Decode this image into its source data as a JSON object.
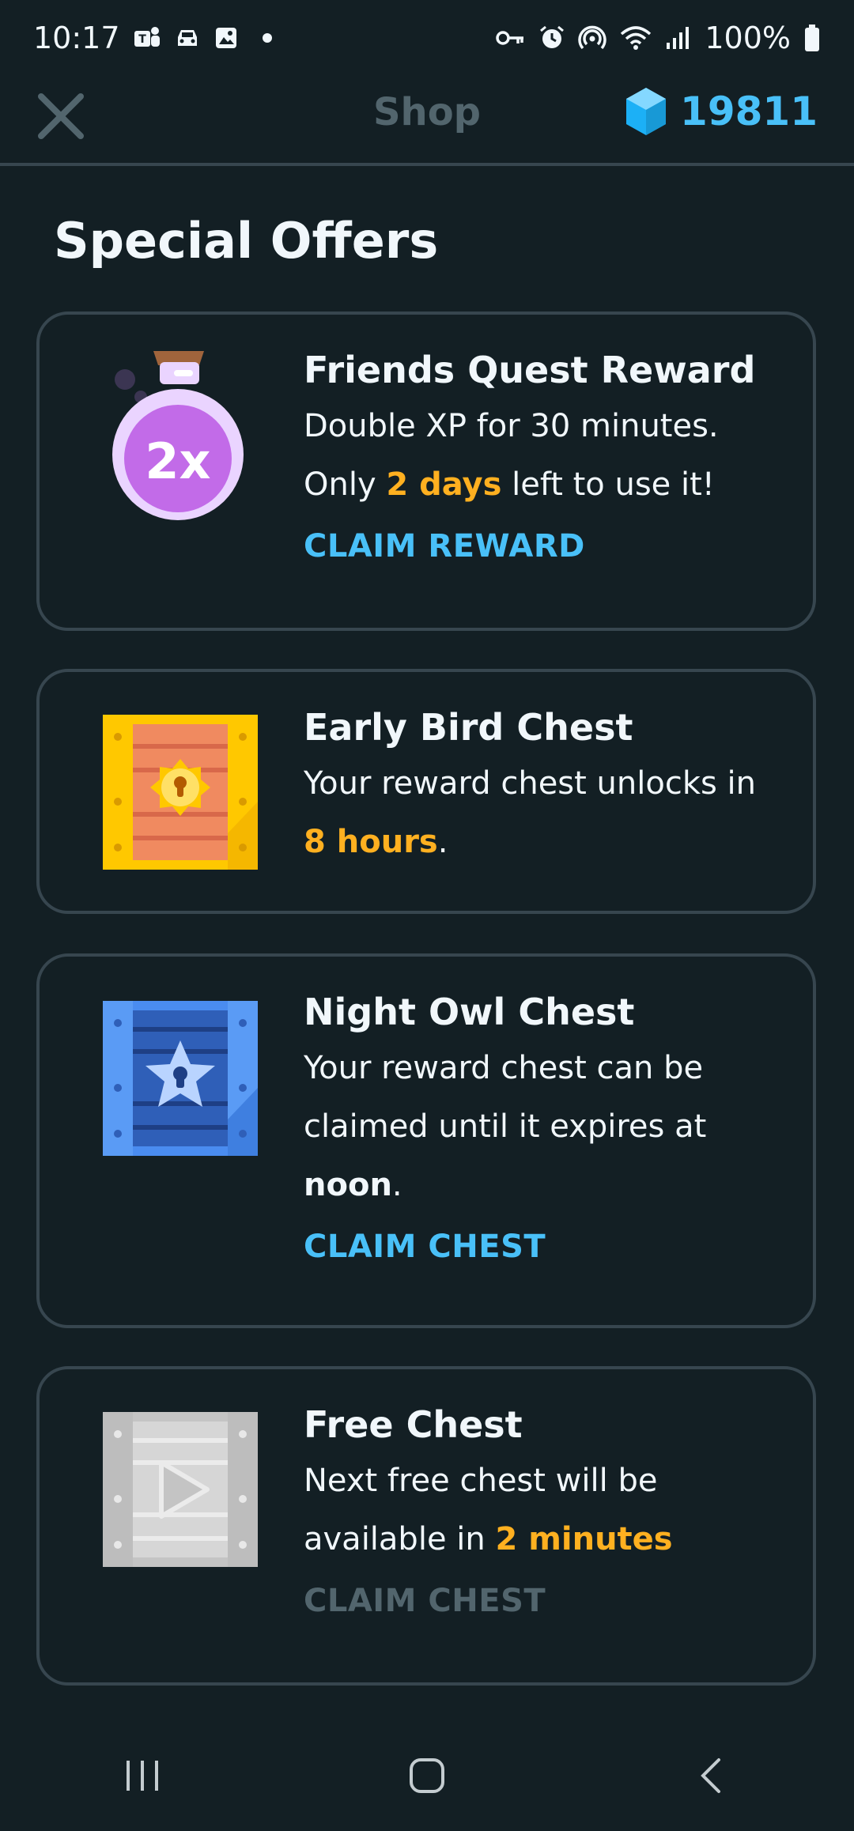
{
  "status_bar": {
    "time": "10:17",
    "battery": "100%",
    "left_icons": [
      "teams-icon",
      "car-icon",
      "gallery-icon"
    ],
    "right_icons": [
      "vpn-key-icon",
      "alarm-icon",
      "hotspot-icon",
      "wifi-icon",
      "signal-icon",
      "battery-icon"
    ]
  },
  "header": {
    "title": "Shop",
    "gems": "19811",
    "close_icon": "close-icon",
    "gem_icon": "gem-icon"
  },
  "section_title": "Special Offers",
  "offers": [
    {
      "icon": "double-xp-potion-icon",
      "title": "Friends Quest Reward",
      "desc_1": "Double XP for 30 minutes.",
      "desc_2a": "Only ",
      "desc_2b": "2 days",
      "desc_2c": " left to use it!",
      "action": "CLAIM REWARD"
    },
    {
      "icon": "early-bird-chest-icon",
      "title": "Early Bird Chest",
      "desc_1": "Your reward chest unlocks in",
      "desc_2a": "8 hours",
      "desc_2b": "."
    },
    {
      "icon": "night-owl-chest-icon",
      "title": "Night Owl Chest",
      "desc_1": "Your reward chest can be",
      "desc_2": "claimed until it expires at",
      "desc_3a": "noon",
      "desc_3b": ".",
      "action": "CLAIM CHEST"
    },
    {
      "icon": "free-chest-icon",
      "title": "Free Chest",
      "desc_1": "Next free chest will be",
      "desc_2a": "available in ",
      "desc_2b": "2 minutes",
      "action": "CLAIM CHEST"
    }
  ],
  "colors": {
    "background": "#131f24",
    "border": "#37464f",
    "accent_blue": "#49c0f8",
    "highlight_orange": "#ffb020",
    "muted": "#52656d"
  },
  "nav": [
    "recent-apps-icon",
    "home-icon",
    "back-icon"
  ]
}
